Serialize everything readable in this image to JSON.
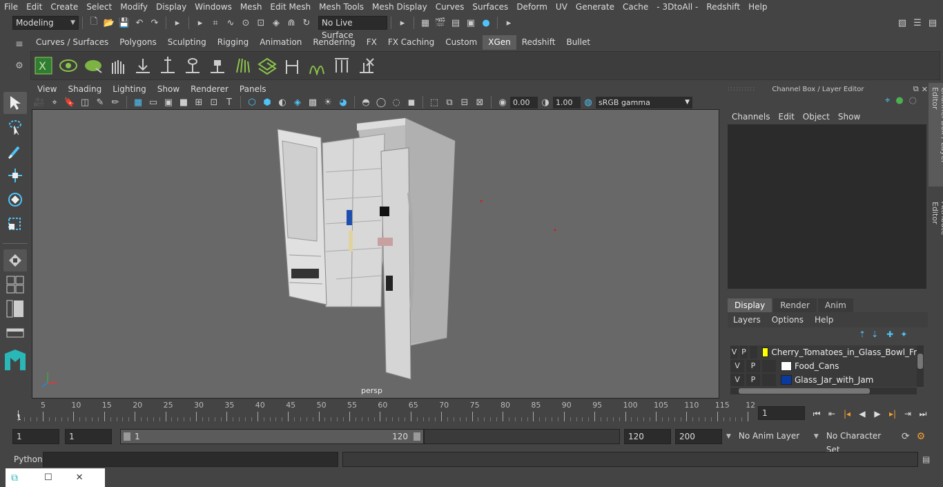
{
  "menubar": [
    "File",
    "Edit",
    "Create",
    "Select",
    "Modify",
    "Display",
    "Windows",
    "Mesh",
    "Edit Mesh",
    "Mesh Tools",
    "Mesh Display",
    "Curves",
    "Surfaces",
    "Deform",
    "UV",
    "Generate",
    "Cache",
    "- 3DtoAll -",
    "Redshift",
    "Help"
  ],
  "status": {
    "mode": "Modeling",
    "live_surface": "No Live Surface"
  },
  "shelf_tabs": [
    "Curves / Surfaces",
    "Polygons",
    "Sculpting",
    "Rigging",
    "Animation",
    "Rendering",
    "FX",
    "FX Caching",
    "Custom",
    "XGen",
    "Redshift",
    "Bullet"
  ],
  "shelf_active": "XGen",
  "viewport": {
    "menu": [
      "View",
      "Shading",
      "Lighting",
      "Show",
      "Renderer",
      "Panels"
    ],
    "exposure": "0.00",
    "gamma": "1.00",
    "color_space": "sRGB gamma",
    "camera_label": "persp"
  },
  "channel_box": {
    "title": "Channel Box / Layer Editor",
    "menu": [
      "Channels",
      "Edit",
      "Object",
      "Show"
    ]
  },
  "side_tabs": [
    "Channel Box / Layer Editor",
    "Attribute Editor"
  ],
  "layer_editor": {
    "tabs": [
      "Display",
      "Render",
      "Anim"
    ],
    "active_tab": "Display",
    "menu": [
      "Layers",
      "Options",
      "Help"
    ],
    "layers": [
      {
        "v": "V",
        "p": "P",
        "color": "#ffff00",
        "name": "Cherry_Tomatoes_in_Glass_Bowl_Fr"
      },
      {
        "v": "V",
        "p": "P",
        "color": "#ffffff",
        "name": "Food_Cans"
      },
      {
        "v": "V",
        "p": "P",
        "color": "#0a3aa0",
        "name": "Glass_Jar_with_Jam"
      }
    ]
  },
  "timeline": {
    "labels": [
      "5",
      "10",
      "15",
      "20",
      "25",
      "30",
      "35",
      "40",
      "45",
      "50",
      "55",
      "60",
      "65",
      "70",
      "75",
      "80",
      "85",
      "90",
      "95",
      "100",
      "105",
      "110",
      "115",
      "12"
    ],
    "start_marker": "1",
    "current_frame": "1"
  },
  "range": {
    "start": "1",
    "playback_start": "1",
    "slider_start": "1",
    "slider_end": "120",
    "playback_end": "120",
    "end": "200",
    "anim_layer": "No Anim Layer",
    "character_set": "No Character Set"
  },
  "command_line": {
    "language": "Python"
  }
}
